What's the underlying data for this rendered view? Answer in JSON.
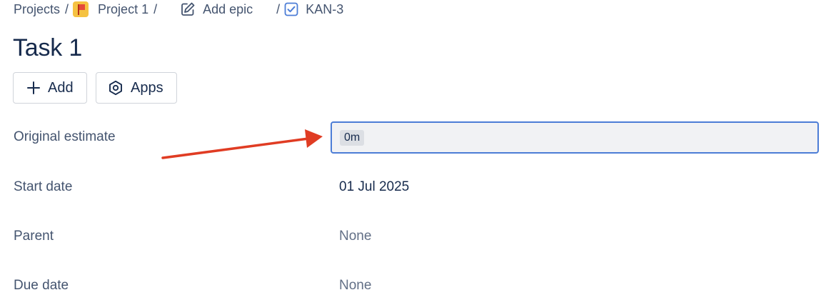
{
  "breadcrumb": {
    "projects": "Projects",
    "project": "Project 1",
    "add_epic": "Add epic",
    "issue_key": "KAN-3",
    "separator": "/"
  },
  "issue": {
    "title": "Task 1"
  },
  "actions": {
    "add_label": "Add",
    "apps_label": "Apps"
  },
  "fields": {
    "original_estimate": {
      "label": "Original estimate",
      "value": "0m"
    },
    "start_date": {
      "label": "Start date",
      "value": "01 Jul 2025"
    },
    "parent": {
      "label": "Parent",
      "value": "None"
    },
    "due_date": {
      "label": "Due date",
      "value": "None"
    }
  },
  "icons": {
    "project": "project-flag-icon",
    "edit": "pencil-square-icon",
    "task": "checkbox-task-icon",
    "add": "plus-icon",
    "apps": "hexagon-apps-icon"
  },
  "colors": {
    "focus_border": "#4c7dd6",
    "annotation_arrow": "#e03c23",
    "task_icon": "#4c7dd6",
    "project_icon_bg": "#f5c242"
  }
}
